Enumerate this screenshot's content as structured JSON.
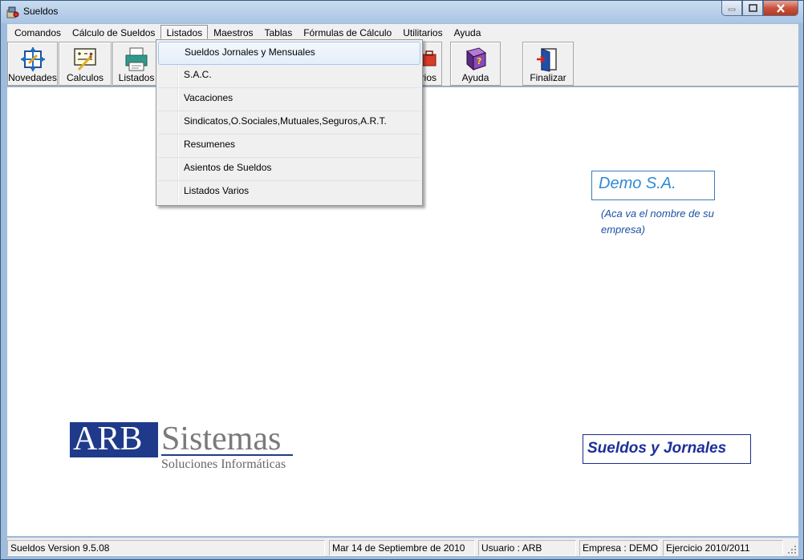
{
  "window": {
    "title": "Sueldos"
  },
  "menubar": {
    "items": [
      "Comandos",
      "Cálculo de Sueldos",
      "Listados",
      "Maestros",
      "Tablas",
      "Fórmulas de Cálculo",
      "Utilitarios",
      "Ayuda"
    ],
    "active": "Listados"
  },
  "toolbar": {
    "novedades": "Novedades",
    "calculos": "Calculos",
    "listados": "Listados",
    "partial": "rios",
    "ayuda": "Ayuda",
    "finalizar": "Finalizar"
  },
  "dropdown": {
    "items": [
      "Sueldos Jornales y Mensuales",
      "S.A.C.",
      "Vacaciones",
      "Sindicatos,O.Sociales,Mutuales,Seguros,A.R.T.",
      "Resumenes",
      "Asientos de Sueldos",
      "Listados Varios"
    ],
    "highlighted": "Sueldos Jornales y Mensuales"
  },
  "client": {
    "company_name": "Demo S.A.",
    "company_note": "(Aca va el nombre de su empresa)",
    "product_name": "Sueldos y Jornales",
    "logo": {
      "left": "ARB",
      "right": "Sistemas",
      "tagline": "Soluciones Informáticas"
    }
  },
  "statusbar": {
    "version": "Sueldos Version 9.5.08",
    "date": "Mar 14 de Septiembre de 2010",
    "user": "Usuario : ARB",
    "company": "Empresa : DEMO",
    "fiscal_year": "Ejercicio 2010/2011"
  },
  "colors": {
    "brand_navy": "#1b2d8a",
    "accent_blue": "#2f8ad6",
    "logo_gray": "#7a7a7a"
  }
}
